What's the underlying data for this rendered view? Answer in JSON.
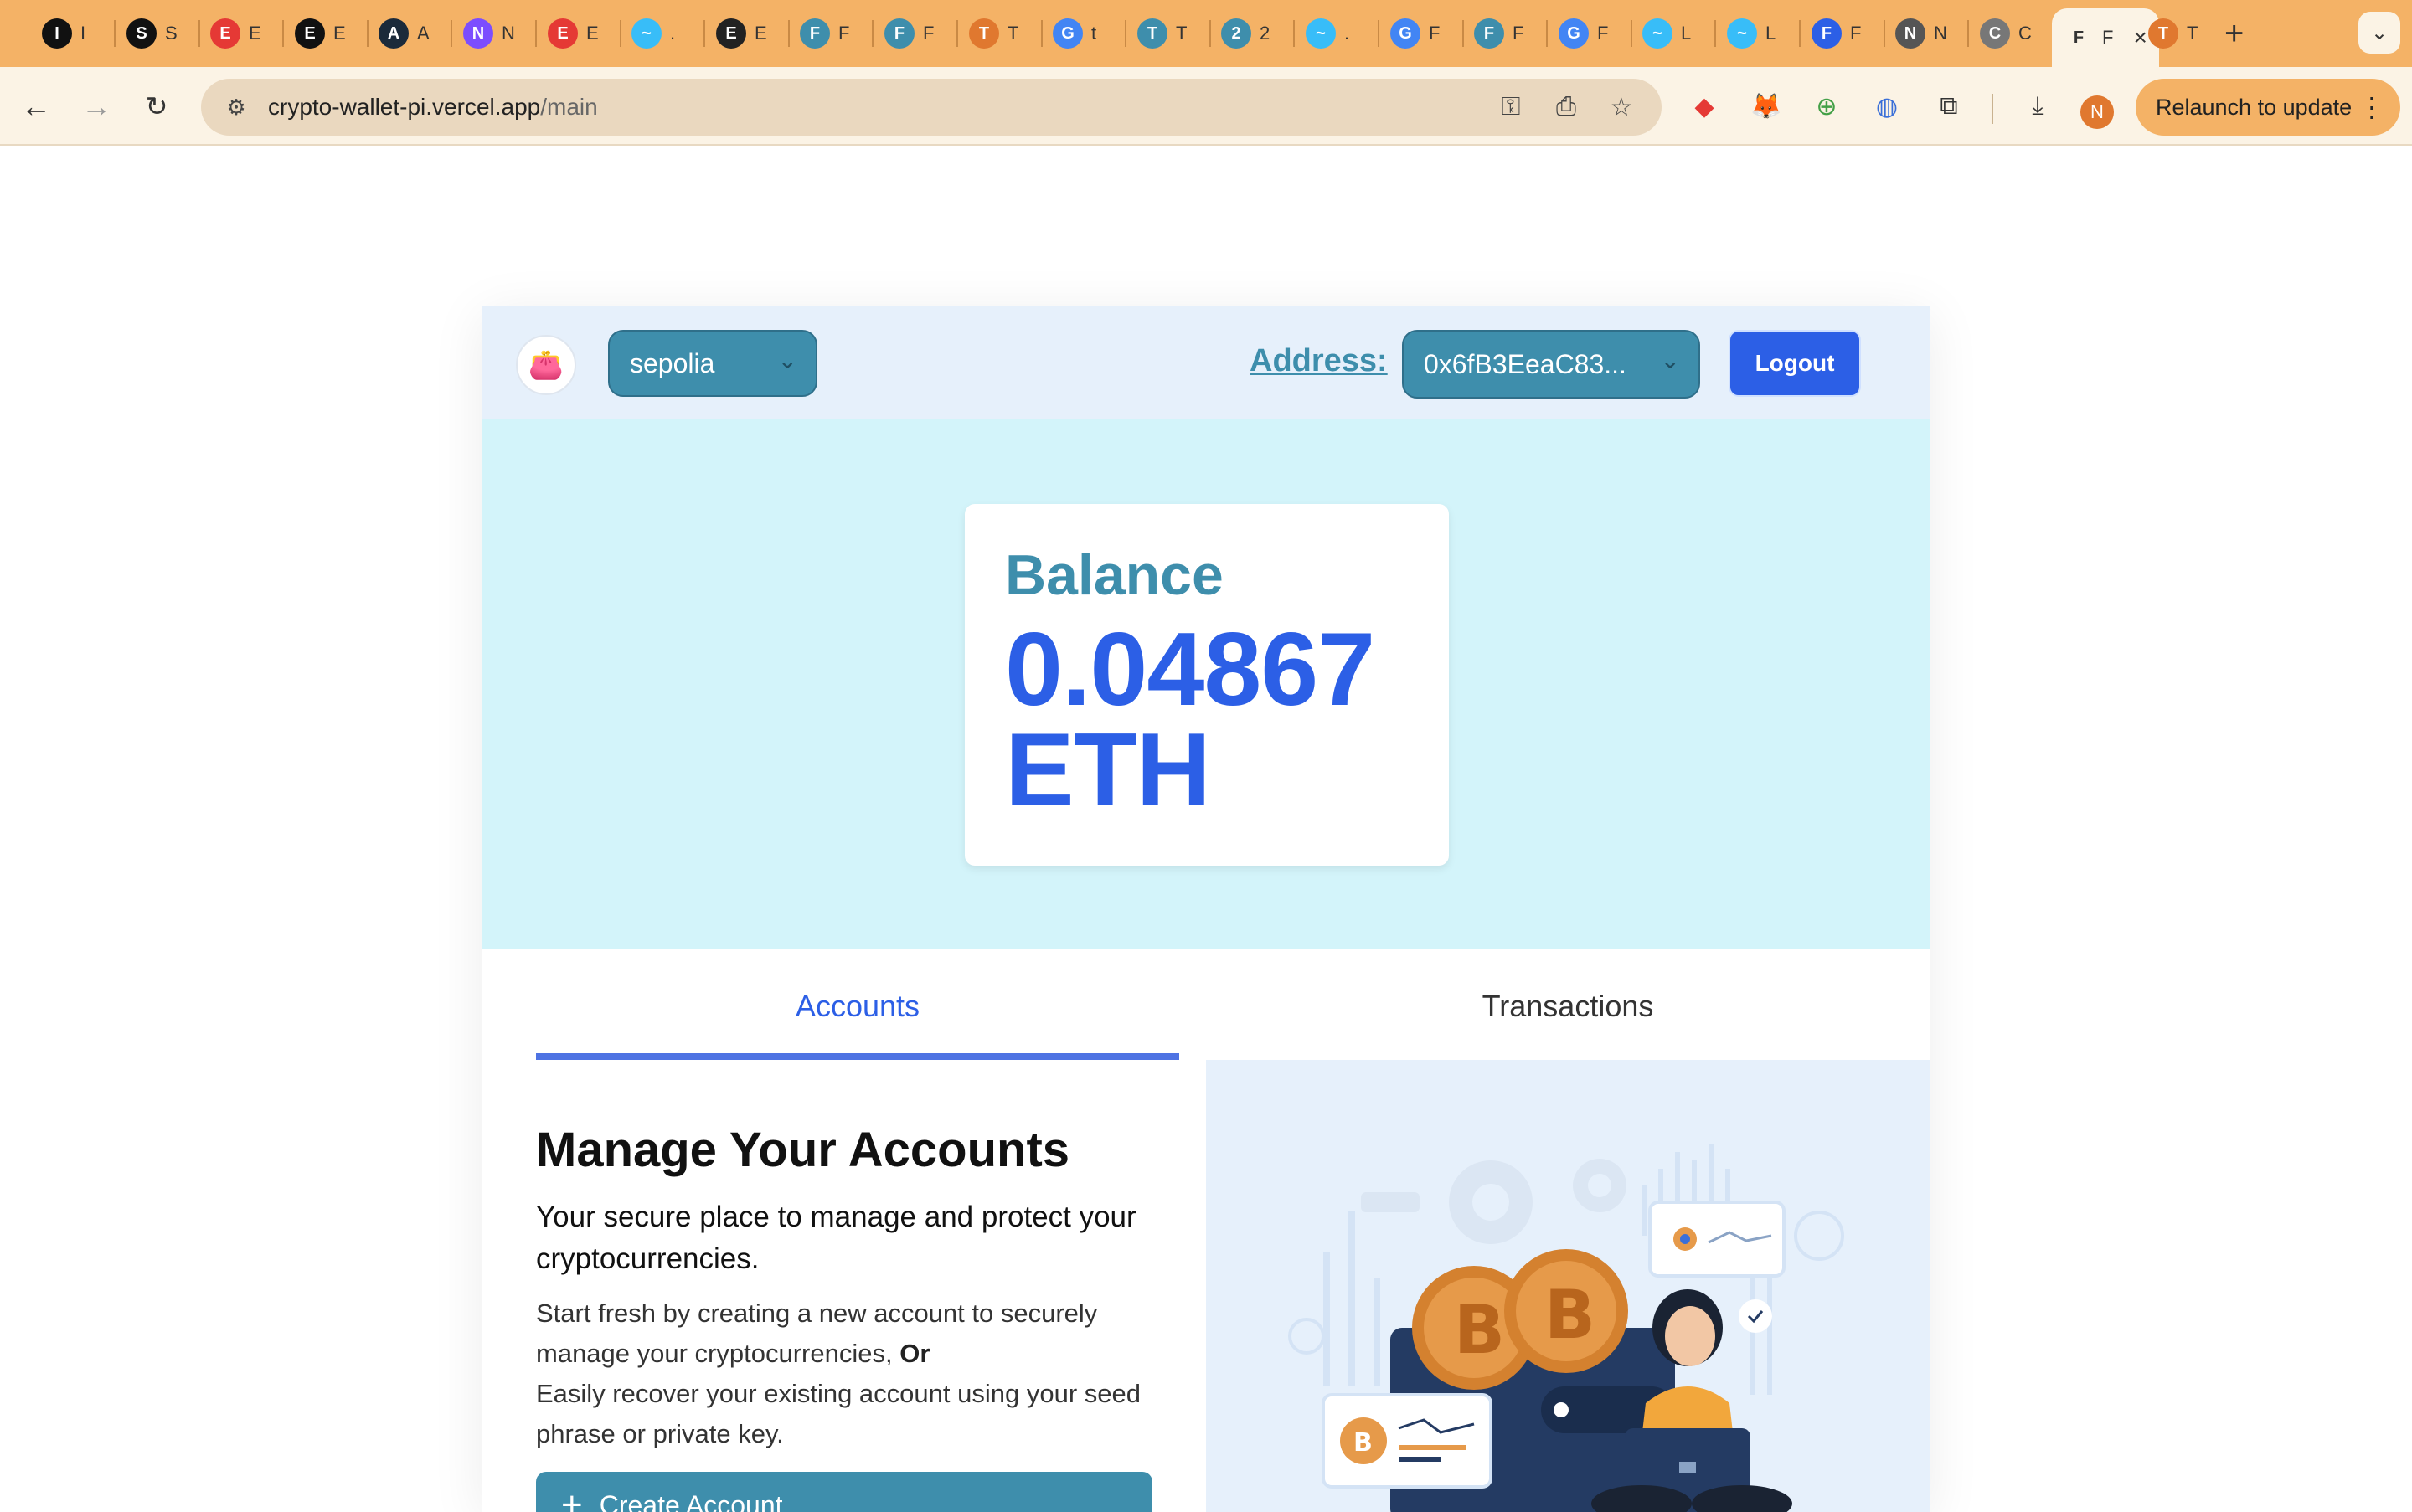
{
  "browser": {
    "tabs": [
      {
        "letter": "I",
        "color": "#111111",
        "label": "I"
      },
      {
        "letter": "S",
        "color": "#111111",
        "label": "S"
      },
      {
        "letter": "E",
        "color": "#e53935",
        "label": "E"
      },
      {
        "letter": "E",
        "color": "#111111",
        "label": "E"
      },
      {
        "letter": "A",
        "color": "#1b2a3a",
        "label": "A"
      },
      {
        "letter": "N",
        "color": "#7c4dff",
        "label": "N"
      },
      {
        "letter": "E",
        "color": "#e53935",
        "label": "E"
      },
      {
        "letter": "~",
        "color": "#38bdf8",
        "label": "."
      },
      {
        "letter": "E",
        "color": "#222222",
        "label": "E"
      },
      {
        "letter": "F",
        "color": "#3e8eac",
        "label": "F"
      },
      {
        "letter": "F",
        "color": "#3e8eac",
        "label": "F"
      },
      {
        "letter": "T",
        "color": "#e0782f",
        "label": "T"
      },
      {
        "letter": "G",
        "color": "#4285f4",
        "label": "t"
      },
      {
        "letter": "T",
        "color": "#3e8eac",
        "label": "T"
      },
      {
        "letter": "2",
        "color": "#3e8eac",
        "label": "2"
      },
      {
        "letter": "~",
        "color": "#38bdf8",
        "label": "."
      },
      {
        "letter": "G",
        "color": "#4285f4",
        "label": "F"
      },
      {
        "letter": "F",
        "color": "#3e8eac",
        "label": "F"
      },
      {
        "letter": "G",
        "color": "#4285f4",
        "label": "F"
      },
      {
        "letter": "~",
        "color": "#38bdf8",
        "label": "L"
      },
      {
        "letter": "~",
        "color": "#38bdf8",
        "label": "L"
      },
      {
        "letter": "F",
        "color": "#2c5fe6",
        "label": "F"
      },
      {
        "letter": "N",
        "color": "#555555",
        "label": "N"
      },
      {
        "letter": "C",
        "color": "#777777",
        "label": "C"
      },
      {
        "letter": "F",
        "color": "#fbf3e5",
        "label": "F"
      },
      {
        "letter": "T",
        "color": "#e0782f",
        "label": "T"
      }
    ],
    "url_host": "crypto-wallet-pi.vercel.app",
    "url_path": "/main",
    "relaunch_label": "Relaunch to update",
    "profile_initial": "N"
  },
  "app": {
    "network": "sepolia",
    "address_label": "Address:",
    "address_value": "0x6fB3EeaC83...",
    "logout_label": "Logout",
    "balance_title": "Balance",
    "balance_amount": "0.04867",
    "balance_unit": "ETH",
    "tabs": {
      "accounts": "Accounts",
      "transactions": "Transactions"
    },
    "manage": {
      "heading": "Manage Your Accounts",
      "subheading": "Your secure place to manage and protect your cryptocurrencies.",
      "desc_1": "Start fresh by creating a new account to securely manage your cryptocurrencies,",
      "desc_or": "Or",
      "desc_2": "Easily recover your existing account using your seed phrase or private key.",
      "create_label": "Create Account"
    }
  },
  "colors": {
    "accent": "#3e8eac",
    "primary": "#2c5fe6",
    "balance_bg": "#d3f4fa",
    "header_bg": "#e6f0fb",
    "tabstrip": "#f4b266"
  }
}
